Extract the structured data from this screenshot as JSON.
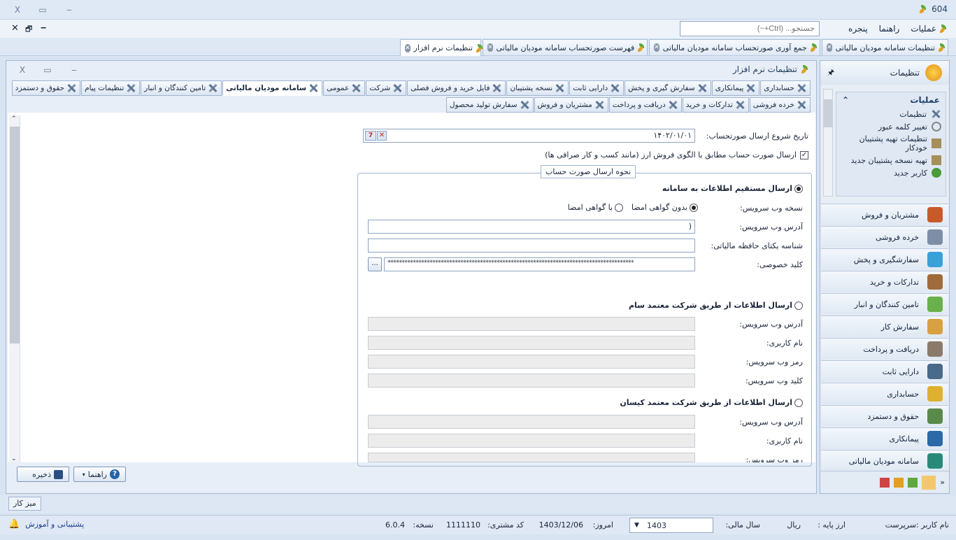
{
  "window": {
    "title": "604",
    "close": "X",
    "restore": "▭",
    "minimize": "‒"
  },
  "menu": {
    "items": [
      "عملیات",
      "راهنما",
      "پنجره"
    ],
    "search_placeholder": "جستجو... (Ctrl+~)",
    "mdi_close": "✕",
    "mdi_restore": "🗗",
    "mdi_min": "‒"
  },
  "doc_tabs": [
    "تنظیمات سامانه مودیان مالیاتی",
    "جمع آوری صورتحساب سامانه مودیان مالیاتی",
    "فهرست صورتحساب سامانه مودیان مالیاتی",
    "تنظیمات نرم افزار"
  ],
  "inner": {
    "title": "تنظیمات نرم افزار",
    "close": "X",
    "restore": "▭",
    "minimize": "‒"
  },
  "settings_tabs_row1": [
    "حسابداری",
    "پیمانکاری",
    "سفارش گیری و پخش",
    "دارایی ثابت",
    "نسخه پشتیبان",
    "فایل خرید و فروش فصلی",
    "شرکت",
    "عمومی",
    "سامانه مودیان مالیاتی",
    "تامین کنندگان و انبار",
    "تنظیمات پیام",
    "حقوق و دستمزد"
  ],
  "settings_tabs_row2": [
    "خرده فروشی",
    "تدارکات و خرید",
    "دریافت و پرداخت",
    "مشتریان و فروش",
    "سفارش تولید محصول"
  ],
  "form": {
    "start_date_label": "تاریخ شروع ارسال صورتحساب:",
    "start_date_value": "۱۴۰۲/۰۱/۰۱",
    "currency_check_label": "ارسال صورت حساب مطابق با الگوی فروش ارز (مانند کسب و کار صرافی ها)",
    "group_title": "نحوه ارسال صورت حساب",
    "direct_radio": "ارسال مستقیم اطلاعات به سامانه",
    "ws_version_label": "نسخه وب سرویس:",
    "no_cert": "بدون گواهی امضا",
    "with_cert": "با گواهی امضا",
    "ws_address_label": "آدرس وب سرویس:",
    "ws_address_value": "(",
    "memory_id_label": "شناسه یکتای حافظه مالیاتی:",
    "private_key_label": "کلید خصوصی:",
    "private_key_value": "****************************************************************************************",
    "browse": "...",
    "sam_radio": "ارسال اطلاعات از طریق شرکت معتمد سام",
    "sam_address_label": "آدرس وب سرویس:",
    "sam_user_label": "نام کاربری:",
    "sam_pass_label": "رمز وب سرویس:",
    "sam_key_label": "کلید وب سرویس:",
    "kisan_radio": "ارسال اطلاعات از طریق شرکت معتمد کیسان",
    "kisan_address_label": "آدرس وب سرویس:",
    "kisan_user_label": "نام کاربری:",
    "kisan_pass_label": "رمز وب سرویس:"
  },
  "buttons": {
    "save": "ذخیره",
    "help": "راهنما"
  },
  "side": {
    "header": "تنظیمات",
    "pin": "🖈",
    "ops_title": "عملیات",
    "ops_items": [
      "تنظیمات",
      "تغییر کلمه عبور",
      "تنظیمات تهیه پشتیبان خودکار",
      "تهیه نسخه پشتیبان جدید",
      "کاربر جدید"
    ],
    "nav": [
      "مشتریان و فروش",
      "خرده فروشی",
      "سفارشگیری و پخش",
      "تدارکات و خرید",
      "تامین کنندگان و انبار",
      "سفارش کار",
      "دریافت و پرداخت",
      "دارایی ثابت",
      "حسابداری",
      "حقوق و دستمزد",
      "پیمانکاری",
      "سامانه مودیان مالیاتی"
    ]
  },
  "taskbar": {
    "desktop": "میز کار"
  },
  "status": {
    "user": "نام کاربر :سرپرست",
    "base_currency": "ارز پایه :",
    "currency": "ریال",
    "fiscal_year_label": "سال مالی:",
    "fiscal_year": "1403",
    "today_label": "امروز:",
    "today": "1403/12/06",
    "customer_code_label": "کد مشتری:",
    "customer_code": "1111110",
    "version_label": "نسخه:",
    "version": "6.0.4",
    "support": "پشتیبانی و آموزش"
  },
  "colors": {
    "accent": "#2563a8",
    "panel": "#e7eef7"
  }
}
